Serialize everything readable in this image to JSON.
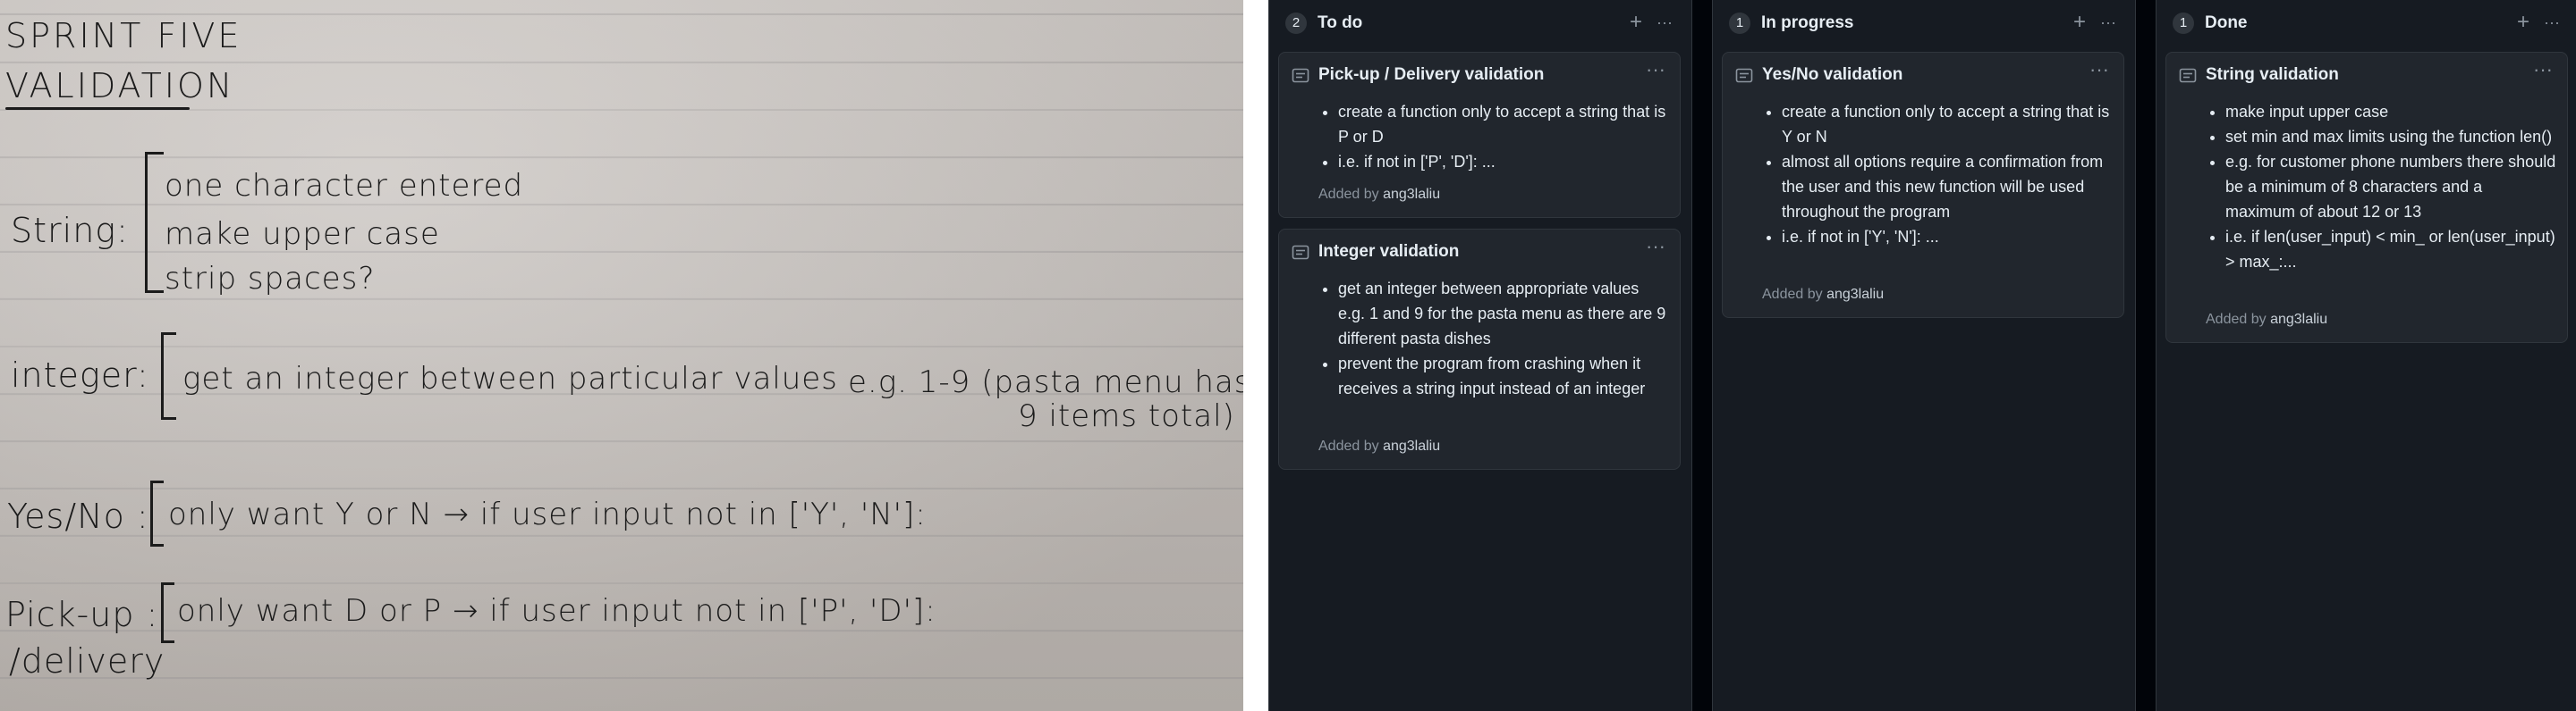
{
  "notes": {
    "title_line1": "SPRINT FIVE",
    "title_line2": "VALIDATION",
    "string_label": "String:",
    "string_items": [
      "one character entered",
      "make upper case",
      "strip spaces?"
    ],
    "integer_label": "integer:",
    "integer_text": "get an integer between particular values",
    "integer_example": "e.g. 1-9 (pasta menu has",
    "integer_example_2": "9 items total)",
    "yesno_label": "Yes/No :",
    "yesno_text": "only want  Y or N → if user input not in ['Y', 'N']:",
    "pickup_label": "Pick-up :",
    "pickup_label_2": "/delivery",
    "pickup_text": "only want  D or P → if user input not in ['P', 'D']:"
  },
  "board": {
    "columns": [
      {
        "count": "2",
        "title": "To do",
        "cards": [
          {
            "title": "Pick-up / Delivery validation",
            "bullets": [
              "create a function only to accept a string that is P or D",
              "i.e. if not in ['P', 'D']: ..."
            ],
            "added_prefix": "Added by",
            "user": "ang3laliu"
          },
          {
            "title": "Integer validation",
            "bullets": [
              "get an integer between appropriate values e.g. 1 and 9 for the pasta menu as there are 9 different pasta dishes",
              "prevent the program from crashing when it receives a string input instead of an integer"
            ],
            "added_prefix": "Added by",
            "user": "ang3laliu"
          }
        ]
      },
      {
        "count": "1",
        "title": "In progress",
        "cards": [
          {
            "title": "Yes/No validation",
            "bullets": [
              "create a function only to accept a string that is Y or N",
              "almost all options require a confirmation from the user and this new function will be used throughout the program",
              "i.e. if not in ['Y', 'N']: ..."
            ],
            "added_prefix": "Added by",
            "user": "ang3laliu"
          }
        ]
      },
      {
        "count": "1",
        "title": "Done",
        "cards": [
          {
            "title": "String validation",
            "bullets": [
              "make input upper case",
              "set min and max limits using the function len()",
              "e.g. for customer phone numbers there should be a minimum of 8 characters and a maximum of about 12 or 13",
              "i.e. if len(user_input) < min_ or len(user_input) > max_:..."
            ],
            "added_prefix": "Added by",
            "user": "ang3laliu"
          }
        ]
      }
    ],
    "icons": {
      "add": "+",
      "more": "···"
    }
  }
}
